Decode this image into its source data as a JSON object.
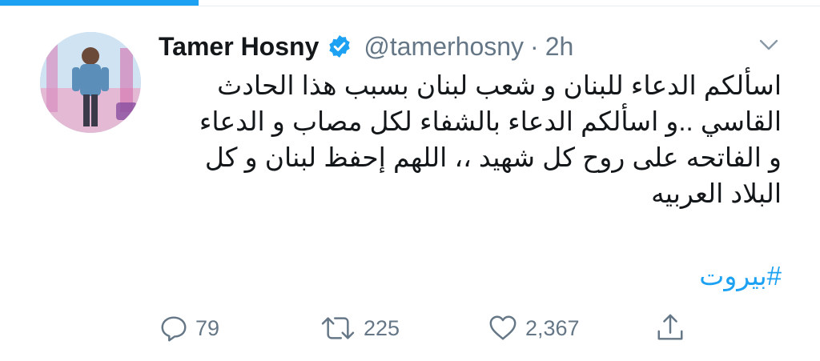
{
  "tweet": {
    "author_name": "Tamer Hosny",
    "handle": "@tamerhosny",
    "separator": "·",
    "time": "2h",
    "text_lines": [
      "اسألكم الدعاء للبنان و شعب لبنان بسبب هذا الحادث",
      "القاسي ..و اسألكم الدعاء بالشفاء لكل مصاب و الدعاء",
      "و الفاتحه على روح كل شهيد ،، اللهم إحفظ لبنان و كل",
      "البلاد العربيه"
    ],
    "hashtag": "#بيروت"
  },
  "actions": {
    "replies": "79",
    "retweets": "225",
    "likes": "2,367"
  },
  "icons": {
    "verified": "verified-badge-icon",
    "more": "chevron-down-icon",
    "reply": "reply-icon",
    "retweet": "retweet-icon",
    "like": "heart-icon",
    "share": "share-icon"
  },
  "colors": {
    "accent": "#1da1f2",
    "secondary_text": "#657786",
    "primary_text": "#14171a"
  }
}
